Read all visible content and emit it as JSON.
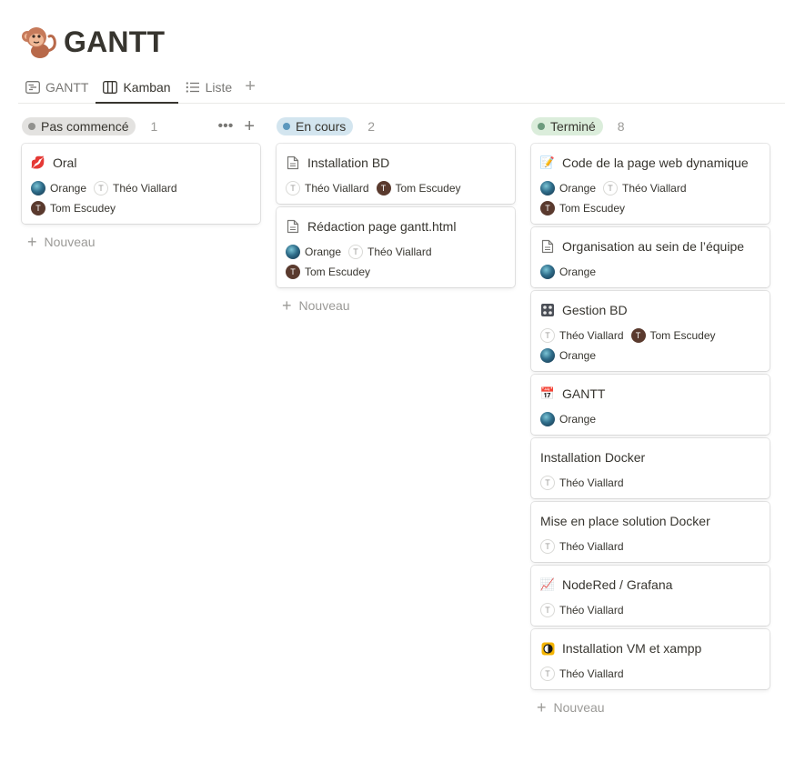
{
  "page": {
    "title": "GANTT",
    "icon": "monkey-icon"
  },
  "tabs": [
    {
      "label": "GANTT",
      "icon": "timeline-icon",
      "active": false
    },
    {
      "label": "Kamban",
      "icon": "board-icon",
      "active": true
    },
    {
      "label": "Liste",
      "icon": "list-icon",
      "active": false
    }
  ],
  "columns": [
    {
      "status": "Pas commencé",
      "count": "1",
      "pill_bg": "#e3e2e0",
      "dot_color": "#91918e",
      "new_label": "Nouveau",
      "cards": [
        {
          "title": "Oral",
          "icon": "lips-icon",
          "icon_glyph": "💋",
          "people": [
            {
              "name": "Orange",
              "avatar": "orange"
            },
            {
              "name": "Théo Viallard",
              "avatar": "theo",
              "initial": "T"
            },
            {
              "name": "Tom Escudey",
              "avatar": "tom",
              "initial": "T"
            }
          ]
        }
      ]
    },
    {
      "status": "En cours",
      "count": "2",
      "pill_bg": "#d3e5ef",
      "dot_color": "#5b97bd",
      "new_label": "Nouveau",
      "cards": [
        {
          "title": "Installation BD",
          "icon": "page-icon",
          "icon_glyph": "",
          "people": [
            {
              "name": "Théo Viallard",
              "avatar": "theo",
              "initial": "T"
            },
            {
              "name": "Tom Escudey",
              "avatar": "tom",
              "initial": "T"
            }
          ]
        },
        {
          "title": "Rédaction page gantt.html",
          "icon": "page-icon",
          "icon_glyph": "",
          "people": [
            {
              "name": "Orange",
              "avatar": "orange"
            },
            {
              "name": "Théo Viallard",
              "avatar": "theo",
              "initial": "T"
            },
            {
              "name": "Tom Escudey",
              "avatar": "tom",
              "initial": "T"
            }
          ]
        }
      ]
    },
    {
      "status": "Terminé",
      "count": "8",
      "pill_bg": "#dbeddb",
      "dot_color": "#6c9b7d",
      "new_label": "Nouveau",
      "cards": [
        {
          "title": "Code de la page web dynamique",
          "icon": "memo-icon",
          "icon_glyph": "📝",
          "people": [
            {
              "name": "Orange",
              "avatar": "orange"
            },
            {
              "name": "Théo Viallard",
              "avatar": "theo",
              "initial": "T"
            },
            {
              "name": "Tom Escudey",
              "avatar": "tom",
              "initial": "T"
            }
          ]
        },
        {
          "title": "Organisation au sein de l’équipe",
          "icon": "page-icon",
          "icon_glyph": "",
          "people": [
            {
              "name": "Orange",
              "avatar": "orange"
            }
          ]
        },
        {
          "title": "Gestion BD",
          "icon": "grid-icon",
          "icon_glyph": "",
          "people": [
            {
              "name": "Théo Viallard",
              "avatar": "theo",
              "initial": "T"
            },
            {
              "name": "Tom Escudey",
              "avatar": "tom",
              "initial": "T"
            },
            {
              "name": "Orange",
              "avatar": "orange"
            }
          ]
        },
        {
          "title": "GANTT",
          "icon": "calendar-icon",
          "icon_glyph": "📅",
          "people": [
            {
              "name": "Orange",
              "avatar": "orange"
            }
          ]
        },
        {
          "title": "Installation Docker",
          "icon": "",
          "icon_glyph": "",
          "people": [
            {
              "name": "Théo Viallard",
              "avatar": "theo",
              "initial": "T"
            }
          ]
        },
        {
          "title": "Mise en place solution Docker",
          "icon": "",
          "icon_glyph": "",
          "people": [
            {
              "name": "Théo Viallard",
              "avatar": "theo",
              "initial": "T"
            }
          ]
        },
        {
          "title": "NodeRed / Grafana",
          "icon": "chart-increasing-icon",
          "icon_glyph": "📈",
          "people": [
            {
              "name": "Théo Viallard",
              "avatar": "theo",
              "initial": "T"
            }
          ]
        },
        {
          "title": "Installation VM et xampp",
          "icon": "vm-icon",
          "icon_glyph": "",
          "people": [
            {
              "name": "Théo Viallard",
              "avatar": "theo",
              "initial": "T"
            }
          ]
        }
      ]
    }
  ]
}
